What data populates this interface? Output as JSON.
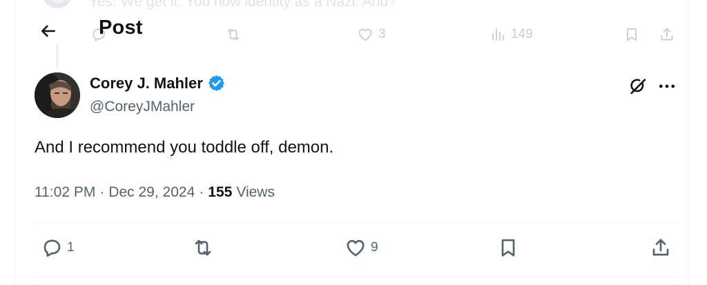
{
  "header": {
    "title": "Post"
  },
  "previous_post": {
    "text": "Yes. We get it. You now identity as a Nazi. And?",
    "actions": {
      "replies": "",
      "reposts": "",
      "likes": "3",
      "views": "149"
    }
  },
  "post": {
    "author": {
      "name": "Corey J. Mahler",
      "handle": "@CoreyJMahler",
      "verified": true
    },
    "text": "And I recommend you toddle off, demon.",
    "time": "11:02 PM",
    "separator": "·",
    "date": "Dec 29, 2024",
    "views_count": "155",
    "views_label": "Views",
    "actions": {
      "replies": "1",
      "reposts": "",
      "likes": "9"
    }
  },
  "icons": {
    "back": "arrow-left-icon",
    "verified": "verified-badge-icon",
    "grok": "grok-icon",
    "more": "more-dots-icon",
    "reply": "reply-icon",
    "repost": "repost-icon",
    "like": "heart-icon",
    "bookmark": "bookmark-icon",
    "share": "share-icon",
    "views": "views-chart-icon"
  },
  "colors": {
    "text": "#0f1419",
    "secondary": "#536471",
    "verified": "#1d9bf0",
    "border": "#eff3f4"
  }
}
